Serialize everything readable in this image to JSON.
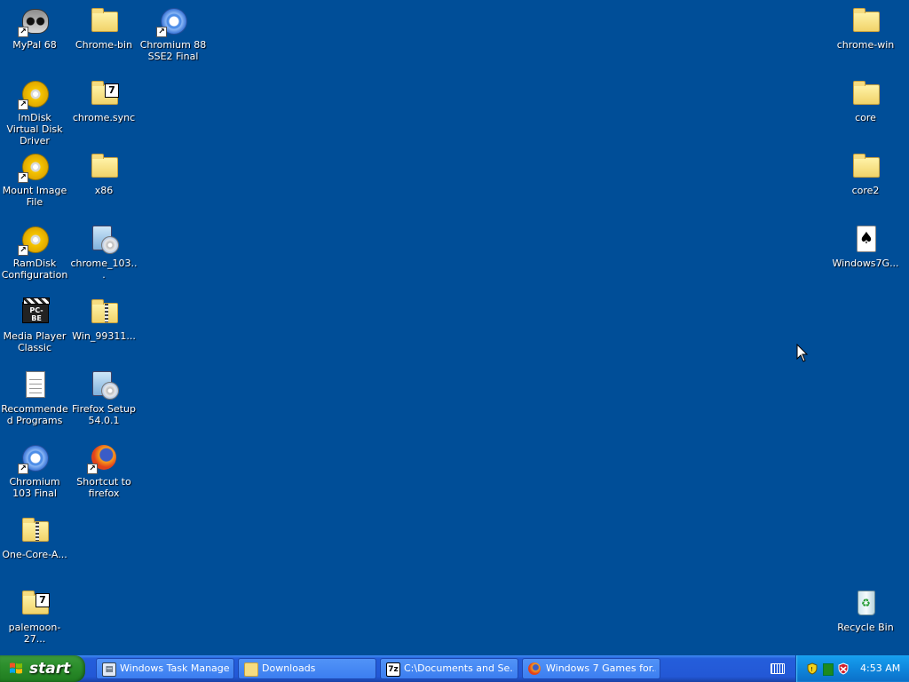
{
  "desktop": {
    "icons": [
      {
        "label": "MyPal 68",
        "icon": "raccoon-browser-icon",
        "shortcut": true
      },
      {
        "label": "Chrome-bin",
        "icon": "folder-icon",
        "shortcut": false
      },
      {
        "label": "Chromium 88 SSE2 Final",
        "icon": "chromium-icon",
        "shortcut": true
      },
      {
        "label": "ImDisk Virtual Disk Driver",
        "icon": "disc-icon",
        "shortcut": true
      },
      {
        "label": "chrome.sync",
        "icon": "7zip-folder-icon",
        "shortcut": false
      },
      {
        "label": "Mount Image File",
        "icon": "disc-icon",
        "shortcut": true
      },
      {
        "label": "x86",
        "icon": "folder-icon",
        "shortcut": false
      },
      {
        "label": "RamDisk Configuration",
        "icon": "disc-icon",
        "shortcut": true
      },
      {
        "label": "chrome_103...",
        "icon": "setup-icon",
        "shortcut": false
      },
      {
        "label": "Media Player Classic",
        "icon": "media-player-icon",
        "shortcut": false
      },
      {
        "label": "Win_99311...",
        "icon": "zip-folder-icon",
        "shortcut": false
      },
      {
        "label": "Recommended Programs",
        "icon": "document-icon",
        "shortcut": false
      },
      {
        "label": "Firefox Setup 54.0.1",
        "icon": "setup-icon",
        "shortcut": false
      },
      {
        "label": "Chromium 103 Final",
        "icon": "chromium-icon",
        "shortcut": true
      },
      {
        "label": "Shortcut to firefox",
        "icon": "firefox-icon",
        "shortcut": true
      },
      {
        "label": "One-Core-A...",
        "icon": "zip-folder-icon",
        "shortcut": false
      },
      {
        "label": "palemoon-27...",
        "icon": "7zip-folder-icon",
        "shortcut": false
      },
      {
        "label": "chrome-win",
        "icon": "folder-icon",
        "shortcut": false
      },
      {
        "label": "core",
        "icon": "folder-icon",
        "shortcut": false
      },
      {
        "label": "core2",
        "icon": "folder-icon",
        "shortcut": false
      },
      {
        "label": "Windows7G...",
        "icon": "card-game-icon",
        "shortcut": false
      },
      {
        "label": "Recycle Bin",
        "icon": "recycle-bin-icon",
        "shortcut": false
      }
    ]
  },
  "taskbar": {
    "start_label": "start",
    "tasks": [
      {
        "label": "Windows Task Manager",
        "icon": "task-manager-icon"
      },
      {
        "label": "Downloads",
        "icon": "folder-icon"
      },
      {
        "label": "C:\\Documents and Se...",
        "icon": "7zip-icon"
      },
      {
        "label": "Windows 7 Games for...",
        "icon": "firefox-icon"
      }
    ],
    "tray": {
      "icons": [
        "shield-icon",
        "green-square-icon",
        "antivirus-icon"
      ],
      "clock": "4:53 AM"
    }
  },
  "colors": {
    "desktop_background": "#004e98",
    "taskbar": "#245edb",
    "start_button": "#2c8f2c",
    "tray": "#0f87dd"
  }
}
